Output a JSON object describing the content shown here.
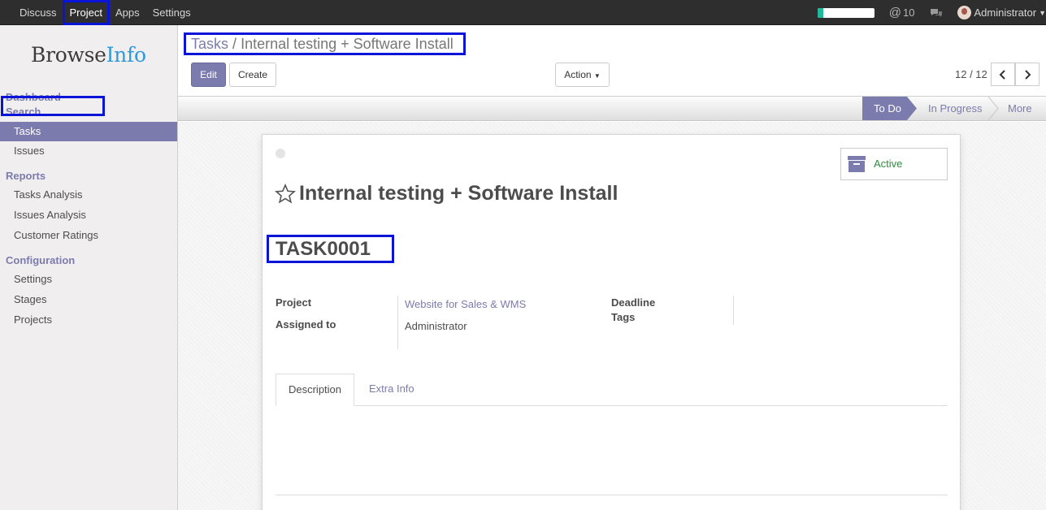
{
  "topbar": {
    "menu": [
      "Discuss",
      "Project",
      "Apps",
      "Settings"
    ],
    "active_menu": "Project",
    "progress": 0.1,
    "mentions_count": "10",
    "user_name": "Administrator"
  },
  "sidebar": {
    "logo_part1": "Browse",
    "logo_part2": "Info",
    "sections": {
      "dashboard": "Dashboard",
      "search": "Search",
      "reports": "Reports",
      "configuration": "Configuration"
    },
    "search_items": [
      "Tasks",
      "Issues"
    ],
    "report_items": [
      "Tasks Analysis",
      "Issues Analysis",
      "Customer Ratings"
    ],
    "config_items": [
      "Settings",
      "Stages",
      "Projects"
    ]
  },
  "control_panel": {
    "breadcrumb_parent": "Tasks",
    "breadcrumb_sep": "/",
    "breadcrumb_current": "Internal testing + Software Install",
    "edit_label": "Edit",
    "create_label": "Create",
    "action_label": "Action",
    "pager": "12 / 12"
  },
  "statusbar": {
    "stages": [
      "To Do",
      "In Progress",
      "More"
    ],
    "current": "To Do"
  },
  "record": {
    "status_label": "Active",
    "title": "Internal testing + Software Install",
    "code": "TASK0001",
    "fields": {
      "project_label": "Project",
      "project_value": "Website for Sales & WMS",
      "assigned_label": "Assigned to",
      "assigned_value": "Administrator",
      "deadline_label": "Deadline",
      "tags_label": "Tags"
    },
    "tabs": [
      "Description",
      "Extra Info"
    ]
  },
  "colors": {
    "brand": "#7c7bad",
    "highlight": "#0a14d9",
    "topbar": "#2e2e2e",
    "active_green": "#2f8a3f"
  }
}
